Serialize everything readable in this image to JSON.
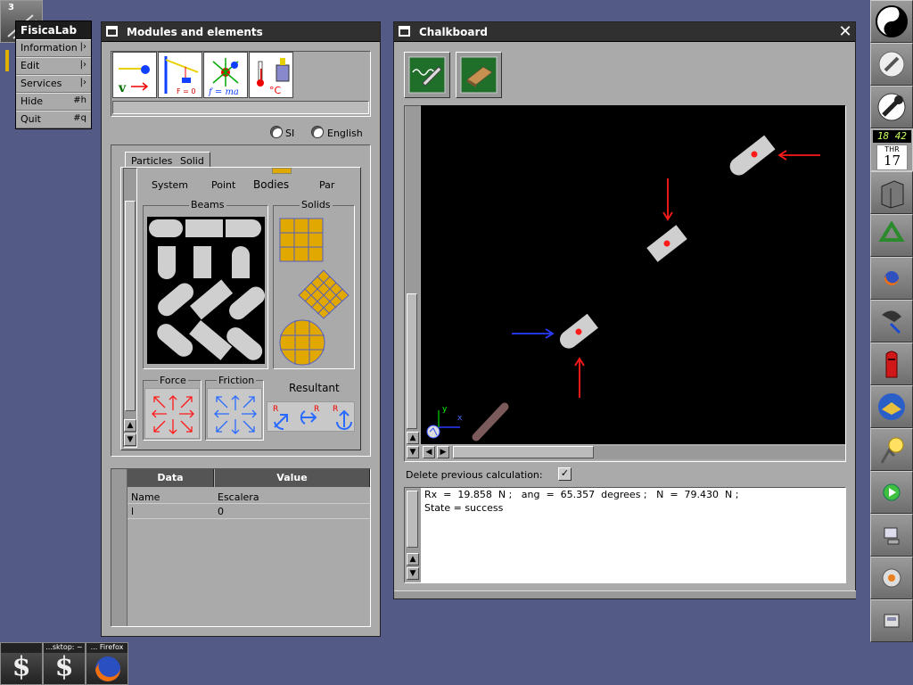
{
  "workspace_number": "3",
  "menu": {
    "title": "FisicaLab",
    "items": [
      {
        "label": "Information",
        "key": "|›"
      },
      {
        "label": "Edit",
        "key": "|›"
      },
      {
        "label": "Services",
        "key": "|›"
      },
      {
        "label": "Hide",
        "key": "#h"
      },
      {
        "label": "Quit",
        "key": "#q"
      }
    ]
  },
  "modules_window": {
    "title": "Modules and elements",
    "module_icons": [
      "kinematics-icon",
      "statics-icon",
      "dynamics-icon",
      "calorimetry-icon"
    ],
    "units": {
      "si_label": "SI",
      "english_label": "English",
      "selected": "none"
    },
    "tabs": [
      {
        "label": "Particles"
      },
      {
        "label": "Solid",
        "active": true
      }
    ],
    "subtabs": [
      "System",
      "Point",
      "Bodies",
      "Par"
    ],
    "groups": {
      "beams": "Beams",
      "solids": "Solids",
      "force": "Force",
      "friction": "Friction",
      "resultant": "Resultant"
    },
    "data_table": {
      "headers": [
        "Data",
        "Value"
      ],
      "rows": [
        {
          "data": "Name",
          "value": "Escalera"
        },
        {
          "data": "l",
          "value": "0"
        }
      ]
    }
  },
  "chalkboard": {
    "title": "Chalkboard",
    "tool_icons": [
      "solve-icon",
      "eraser-icon"
    ],
    "delete_previous_label": "Delete previous calculation:",
    "delete_previous_checked": true,
    "output": {
      "line1": "Rx  =  19.858  N ;   ang  =  65.357  degrees ;   N  =  79.430  N ;",
      "line2": "State = success"
    },
    "axis_labels": {
      "x": "x",
      "y": "y"
    },
    "colors": {
      "force_red": "#ff1a1a",
      "force_blue": "#2a3bff",
      "body": "#cfcfcf",
      "beam": "#7a5a5a"
    }
  },
  "clock": {
    "time": "18 42",
    "day": "THR",
    "date": "17"
  },
  "taskbar": [
    {
      "label": "",
      "icon": "terminal-icon"
    },
    {
      "label": "...sktop: ~",
      "icon": "terminal-icon"
    },
    {
      "label": "... Firefox",
      "icon": "firefox-icon"
    }
  ]
}
